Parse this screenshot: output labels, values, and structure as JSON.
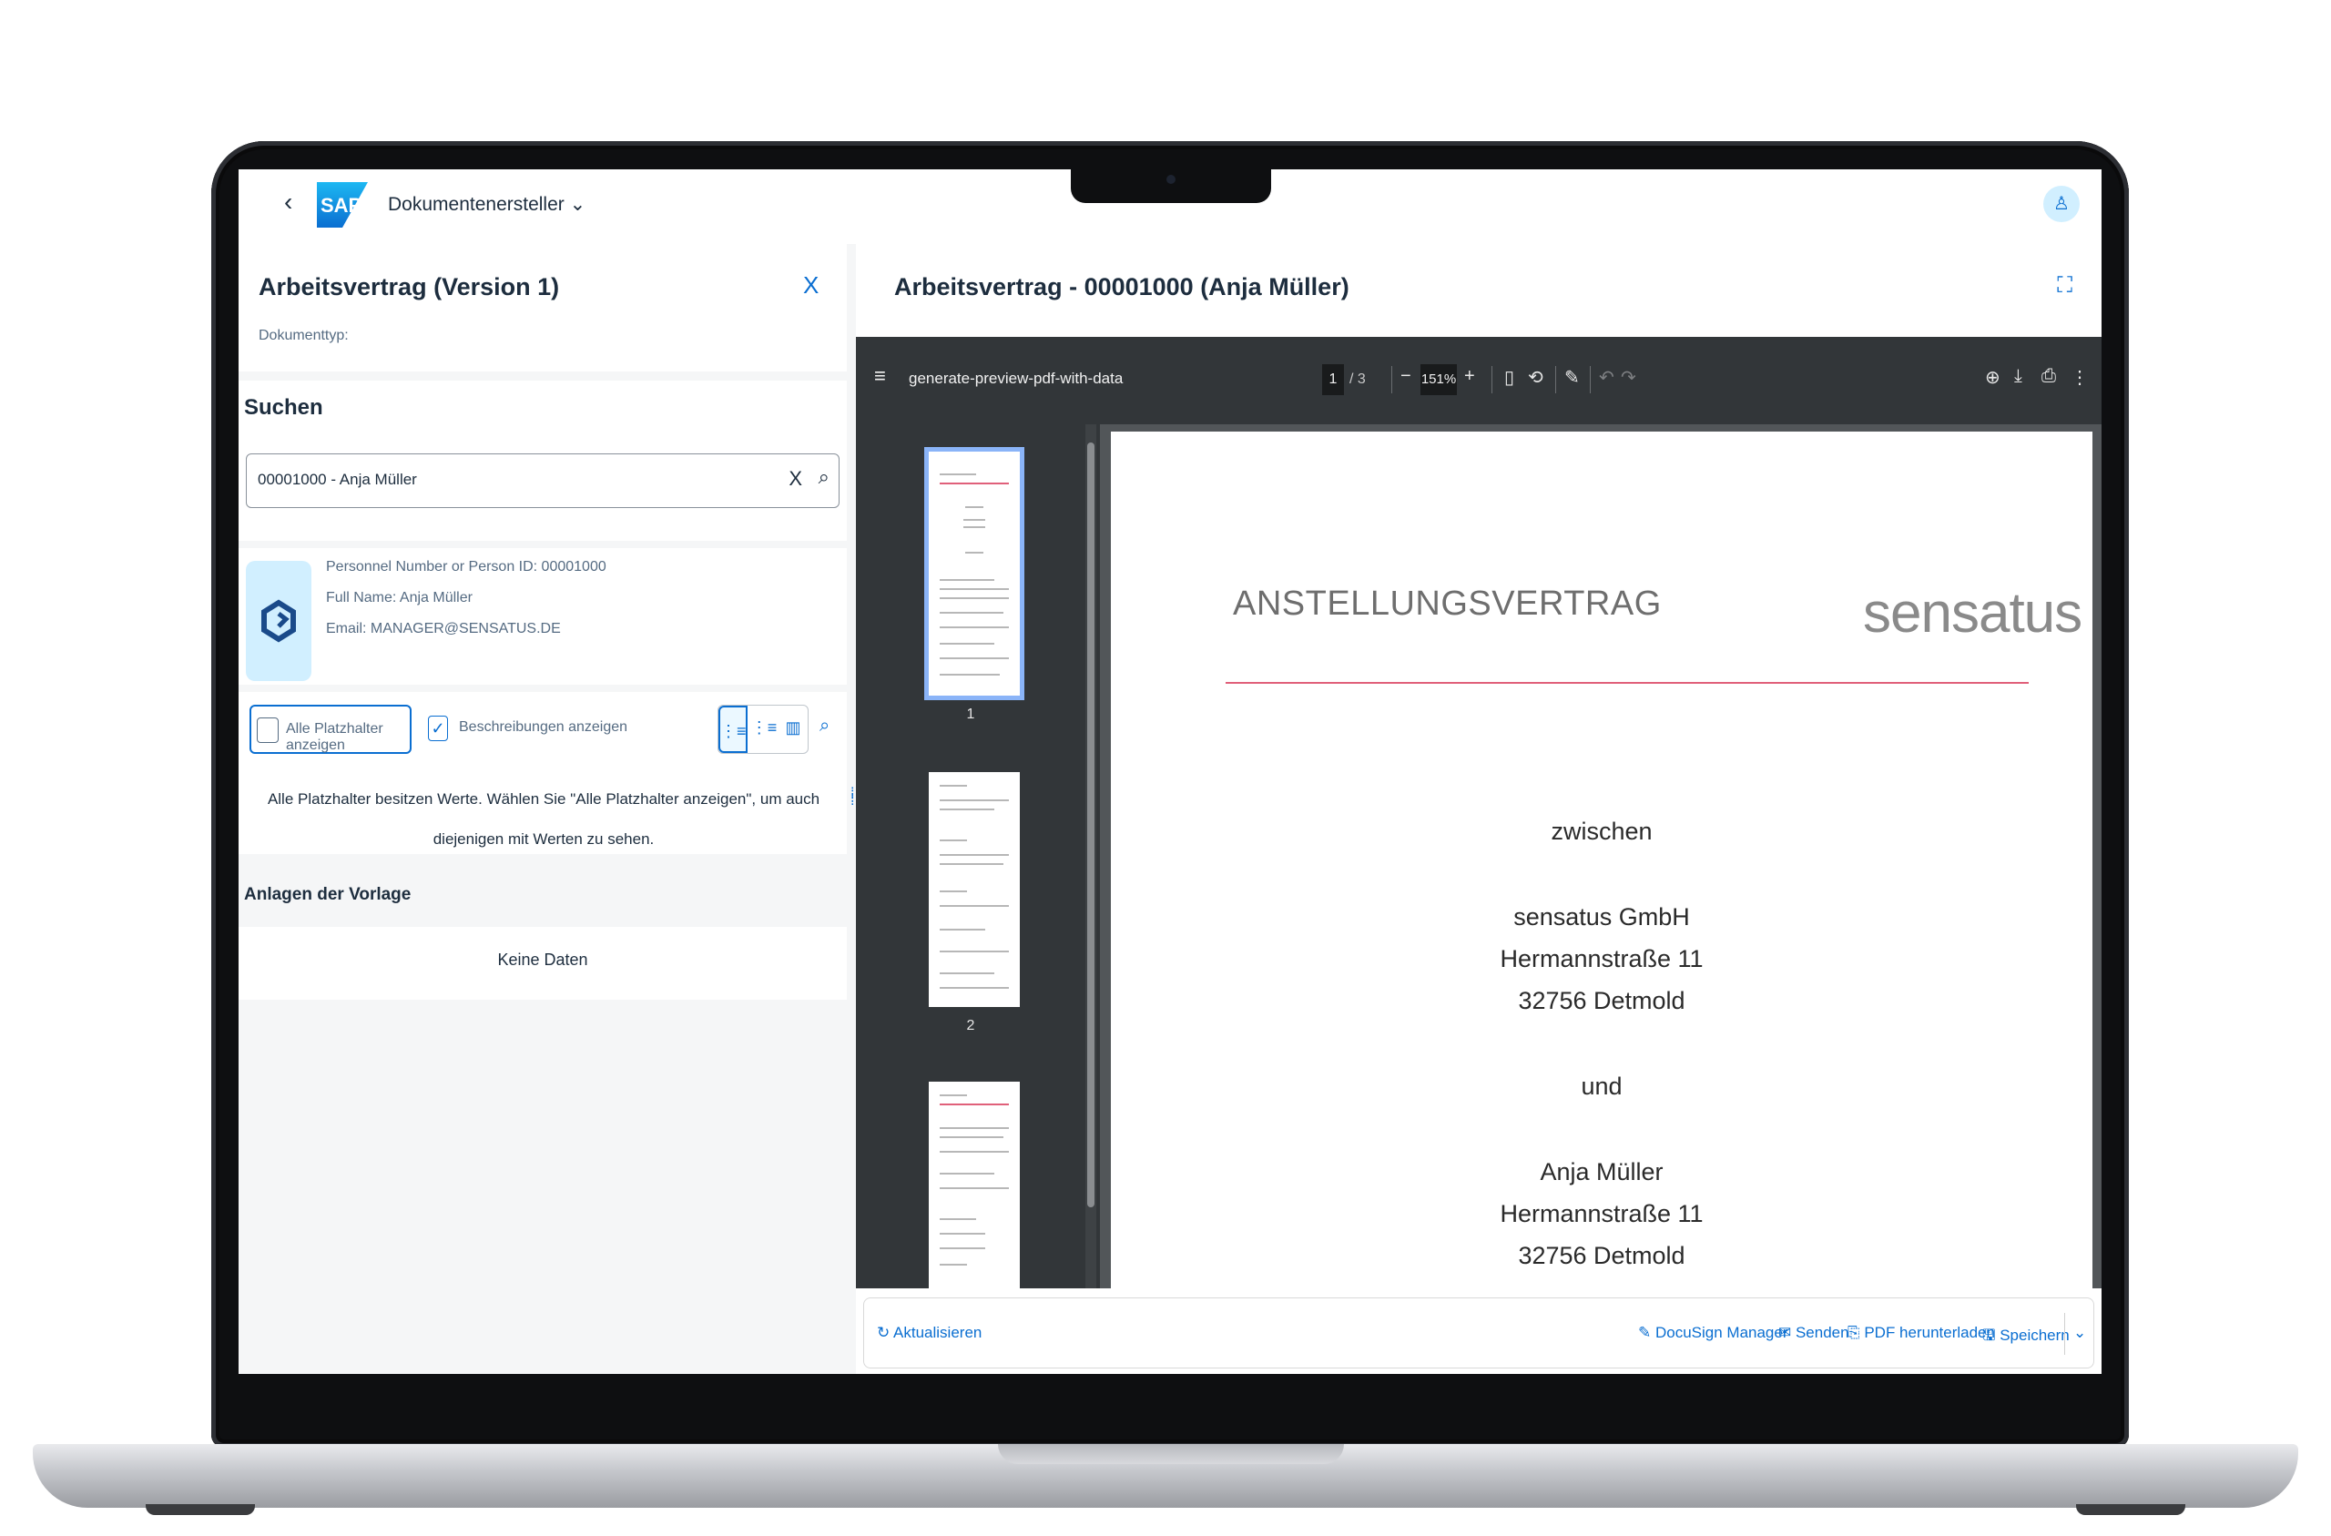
{
  "shell": {
    "back": "‹",
    "logo": "SAP",
    "app_title": "Dokumentenersteller ⌄",
    "avatar": "♙"
  },
  "left": {
    "doc_title": "Arbeitsvertrag (Version 1)",
    "doc_type_label": "Dokumenttyp:",
    "close": "X",
    "search_header": "Suchen",
    "search_value": "00001000 - Anja Müller",
    "clear": "X",
    "search_icon": "⌕",
    "person": {
      "id_line": "Personnel Number or Person ID: 00001000",
      "name_line": "Full Name: Anja Müller",
      "email_line": "Email: MANAGER@SENSATUS.DE"
    },
    "show_all_label": "Alle Platzhalter anzeigen",
    "show_desc_label": "Beschreibungen anzeigen",
    "show_desc_checked": "✓",
    "seg_icons": [
      "⋮≡",
      "⋮≡",
      "▥"
    ],
    "extra_icon": "⌕",
    "info_message": "Alle Platzhalter besitzen Werte. Wählen Sie \"Alle Platzhalter anzeigen\", um auch diejenigen mit Werten zu sehen.",
    "attachments_header": "Anlagen der Vorlage",
    "no_data": "Keine Daten"
  },
  "right": {
    "title": "Arbeitsvertrag - 00001000 (Anja Müller)",
    "expand_icon": "⛶",
    "viewer": {
      "menu": "≡",
      "filename": "generate-preview-pdf-with-data",
      "page": "1",
      "page_of": "/ 3",
      "zoom_out": "−",
      "zoom": "151%",
      "zoom_in": "+",
      "fit_icon": "▯",
      "rotate_icon": "⟲",
      "annotate_icon": "✎",
      "undo_icon": "↶",
      "redo_icon": "↷",
      "add_icon": "⊕",
      "download_icon": "⤓",
      "print_icon": "⎙",
      "more_icon": "⋮",
      "thumb_labels": [
        "1",
        "2"
      ]
    },
    "document": {
      "heading": "ANSTELLUNGSVERTRAG",
      "logo": "sensatus",
      "lines": [
        "zwischen",
        "sensatus GmbH",
        "Hermannstraße 11",
        "32756 Detmold",
        "und",
        "Anja Müller",
        "Hermannstraße 11",
        "32756 Detmold"
      ]
    },
    "footer": {
      "refresh": "↻ Aktualisieren",
      "docusign": "✎ DocuSign Manager",
      "send": "✉ Senden",
      "download_pdf": "⎘ PDF herunterladen",
      "save": "🖫 Speichern",
      "save_menu": "⌄"
    }
  }
}
